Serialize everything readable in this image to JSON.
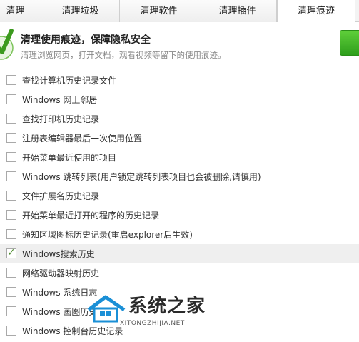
{
  "tabs": [
    {
      "label": "清理",
      "active": false
    },
    {
      "label": "清理垃圾",
      "active": false
    },
    {
      "label": "清理软件",
      "active": false
    },
    {
      "label": "清理插件",
      "active": false
    },
    {
      "label": "清理痕迹",
      "active": true
    }
  ],
  "banner": {
    "title": "清理使用痕迹，保障隐私安全",
    "description": "清理浏览网页，打开文档，观看视频等留下的使用痕迹。"
  },
  "items": [
    {
      "label": "查找计算机历史记录文件",
      "checked": false
    },
    {
      "label": "Windows 网上邻居",
      "checked": false
    },
    {
      "label": "查找打印机历史记录",
      "checked": false
    },
    {
      "label": "注册表编辑器最后一次使用位置",
      "checked": false
    },
    {
      "label": "开始菜单最近使用的项目",
      "checked": false
    },
    {
      "label": "Windows 跳转列表(用户锁定跳转列表项目也会被删除,请慎用)",
      "checked": false
    },
    {
      "label": "文件扩展名历史记录",
      "checked": false
    },
    {
      "label": "开始菜单最近打开的程序的历史记录",
      "checked": false
    },
    {
      "label": "通知区域图标历史记录(重启explorer后生效)",
      "checked": false
    },
    {
      "label": "Windows搜索历史",
      "checked": true
    },
    {
      "label": "网络驱动器映射历史",
      "checked": false
    },
    {
      "label": "Windows 系统日志",
      "checked": false
    },
    {
      "label": "Windows 画图历史记录",
      "checked": false
    },
    {
      "label": "Windows 控制台历史记录",
      "checked": false
    }
  ],
  "watermark": {
    "title": "系统之家",
    "subtitle": "XITONGZHIJIA.NET"
  },
  "colors": {
    "check_accent": "#4a8a2a",
    "action_button": "#3fae25"
  }
}
